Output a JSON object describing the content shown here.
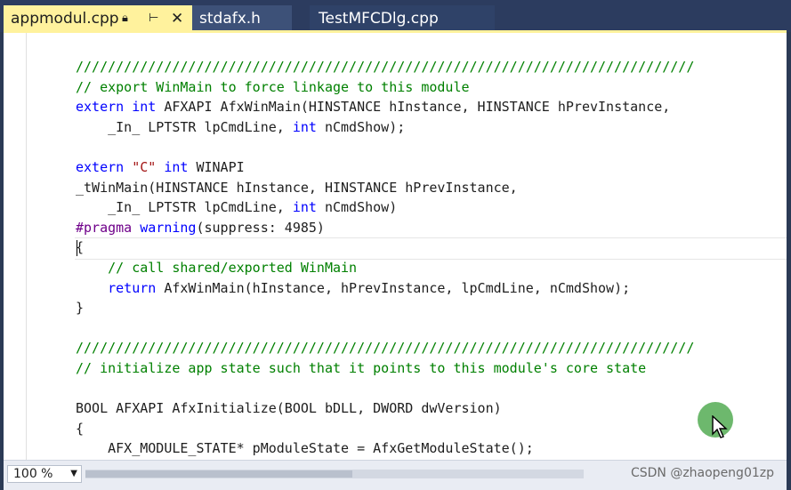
{
  "tabs": [
    {
      "label": "appmodul.cpp",
      "active": true
    },
    {
      "label": "stdafx.h",
      "active": false
    },
    {
      "label": "TestMFCDlg.cpp",
      "active": false
    }
  ],
  "tab_icons": {
    "lock": "lock-icon",
    "pin": "pin-icon",
    "close": "close-icon"
  },
  "colors": {
    "active_tab": "#fff29d",
    "keyword": "#0000ff",
    "comment": "#008000",
    "string": "#a31515",
    "preprocessor": "#6f008a"
  },
  "code_lines": [
    [
      {
        "t": "/////////////////////////////////////////////////////////////////////////////",
        "c": "cm"
      }
    ],
    [
      {
        "t": "// export WinMain to force linkage to this module",
        "c": "cm"
      }
    ],
    [
      {
        "t": "extern",
        "c": "kw"
      },
      {
        "t": " "
      },
      {
        "t": "int",
        "c": "kw"
      },
      {
        "t": " AFXAPI AfxWinMain(HINSTANCE hInstance, HINSTANCE hPrevInstance,"
      }
    ],
    [
      {
        "t": "    _In_ LPTSTR lpCmdLine, "
      },
      {
        "t": "int",
        "c": "kw"
      },
      {
        "t": " nCmdShow);"
      }
    ],
    [],
    [
      {
        "t": "extern",
        "c": "kw"
      },
      {
        "t": " "
      },
      {
        "t": "\"C\"",
        "c": "st"
      },
      {
        "t": " "
      },
      {
        "t": "int",
        "c": "kw"
      },
      {
        "t": " WINAPI"
      }
    ],
    [
      {
        "t": "_tWinMain(HINSTANCE hInstance, HINSTANCE hPrevInstance,"
      }
    ],
    [
      {
        "t": "    _In_ LPTSTR lpCmdLine, "
      },
      {
        "t": "int",
        "c": "kw"
      },
      {
        "t": " nCmdShow)"
      }
    ],
    [
      {
        "t": "#pragma",
        "c": "pp"
      },
      {
        "t": " "
      },
      {
        "t": "warning",
        "c": "kw"
      },
      {
        "t": "(suppress: 4985)"
      }
    ],
    [
      {
        "t": "{"
      }
    ],
    [
      {
        "t": "    "
      },
      {
        "t": "// call shared/exported WinMain",
        "c": "cm"
      }
    ],
    [
      {
        "t": "    "
      },
      {
        "t": "return",
        "c": "kw"
      },
      {
        "t": " AfxWinMain(hInstance, hPrevInstance, lpCmdLine, nCmdShow);"
      }
    ],
    [
      {
        "t": "}"
      }
    ],
    [],
    [
      {
        "t": "/////////////////////////////////////////////////////////////////////////////",
        "c": "cm"
      }
    ],
    [
      {
        "t": "// initialize app state such that it points to this module's core state",
        "c": "cm"
      }
    ],
    [],
    [
      {
        "t": "BOOL AFXAPI AfxInitialize(BOOL bDLL, DWORD dwVersion)"
      }
    ],
    [
      {
        "t": "{"
      }
    ],
    [
      {
        "t": "    AFX_MODULE_STATE* pModuleState = AfxGetModuleState();"
      }
    ]
  ],
  "status": {
    "zoom": "100 %"
  },
  "watermark": "CSDN @zhaopeng01zp"
}
